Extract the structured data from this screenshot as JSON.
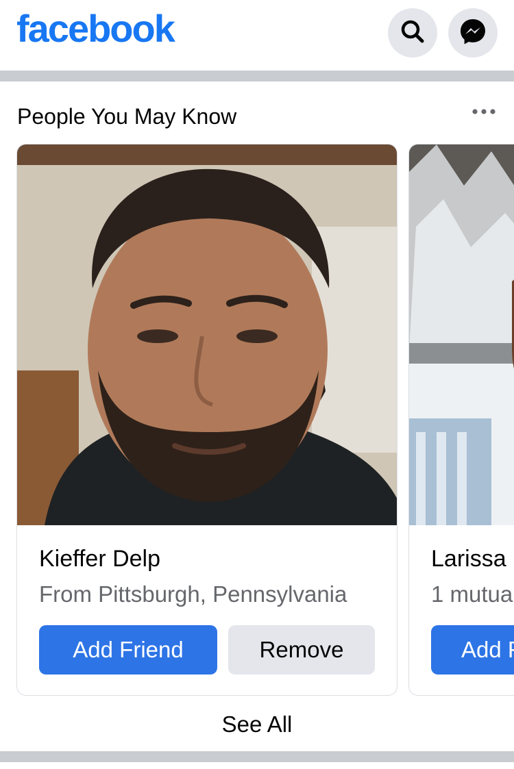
{
  "header": {
    "logo_text": "facebook",
    "search_icon": "search-icon",
    "messenger_icon": "messenger-icon"
  },
  "section": {
    "title": "People You May Know",
    "more_icon": "more-dots-icon",
    "see_all_label": "See All"
  },
  "people": [
    {
      "name": "Kieffer Delp",
      "subtitle": "From Pittsburgh, Pennsylvania",
      "add_label": "Add Friend",
      "remove_label": "Remove"
    },
    {
      "name": "Larissa",
      "subtitle": "1 mutua",
      "add_label": "Add F"
    }
  ],
  "colors": {
    "brand": "#1877f2",
    "primary_button": "#2d74e6",
    "secondary_button": "#e4e6eb",
    "divider": "#c9ccd1",
    "secondary_text": "#65676b"
  }
}
